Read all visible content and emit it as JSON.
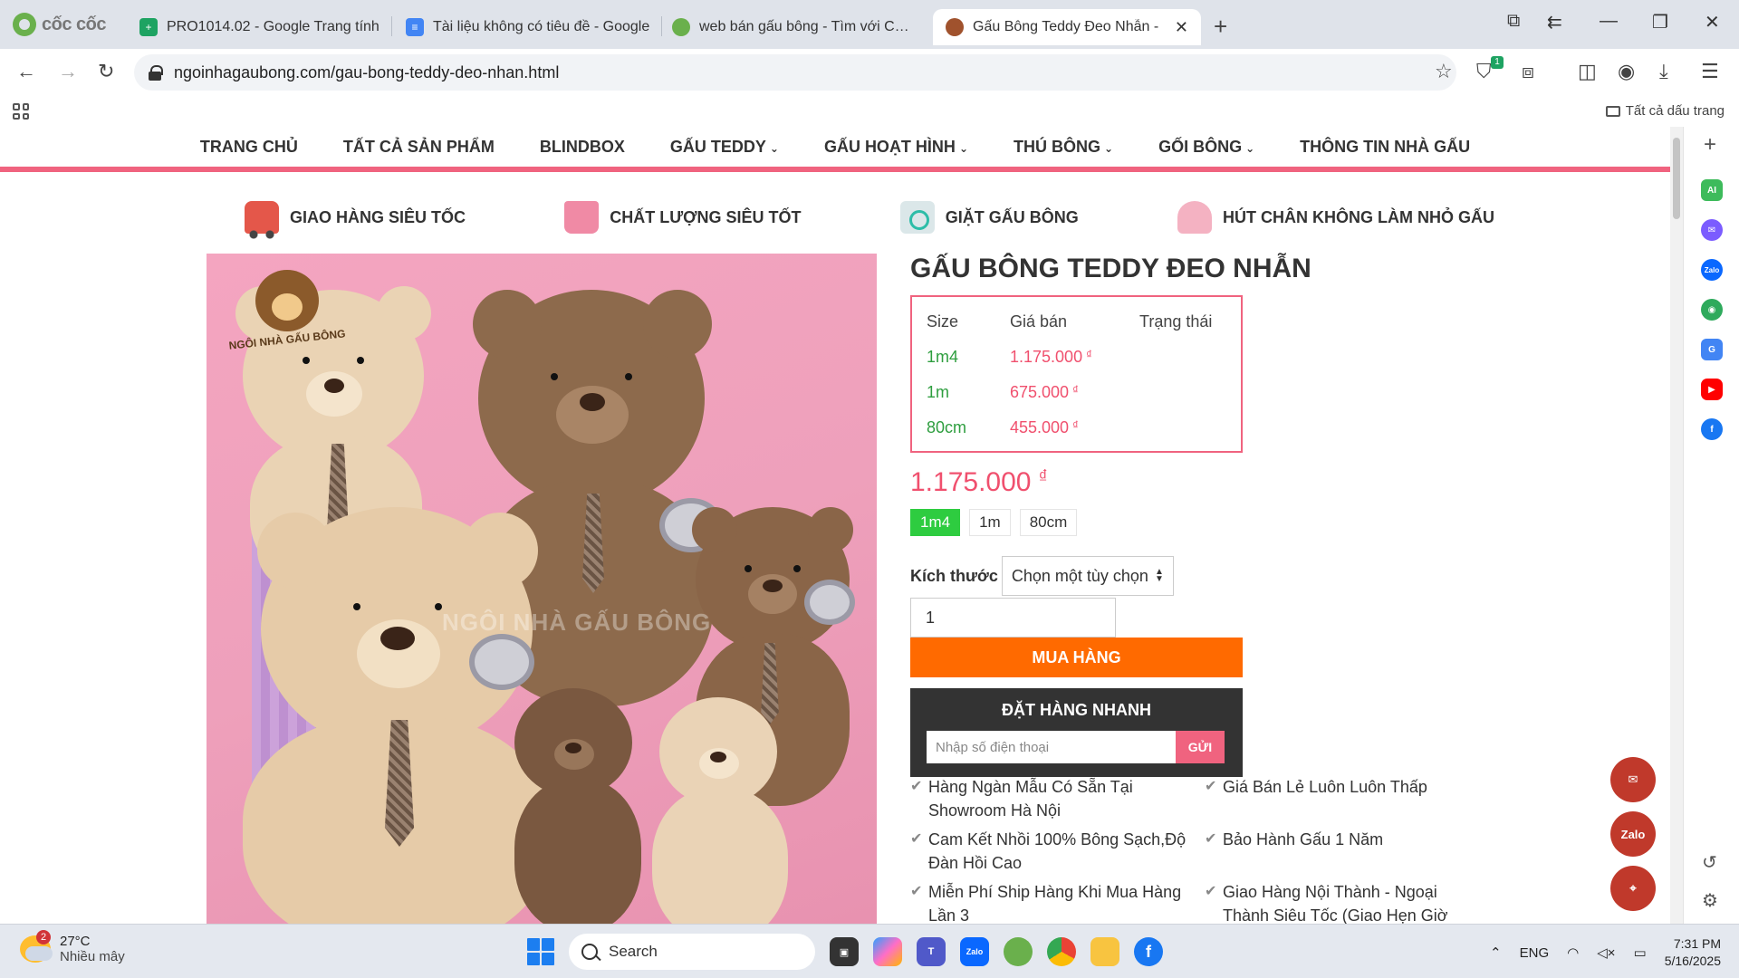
{
  "browser": {
    "brand": "cốc cốc",
    "tabs": [
      {
        "title": "PRO1014.02 - Google Trang tính"
      },
      {
        "title": "Tài liệu không có tiêu đề - Google"
      },
      {
        "title": "web bán gấu bông - Tìm với Cốc C"
      },
      {
        "title": "Gấu Bông Teddy Đeo Nhẫn -"
      }
    ],
    "url": "ngoinhagaubong.com/gau-bong-teddy-deo-nhan.html",
    "extension_badge": "1",
    "all_bookmarks": "Tất cả dấu trang"
  },
  "site": {
    "nav": [
      {
        "label": "TRANG CHỦ",
        "caret": false
      },
      {
        "label": "TẤT CẢ SẢN PHẨM",
        "caret": false
      },
      {
        "label": "BLINDBOX",
        "caret": false
      },
      {
        "label": "GẤU TEDDY",
        "caret": true
      },
      {
        "label": "GẤU HOẠT HÌNH",
        "caret": true
      },
      {
        "label": "THÚ BÔNG",
        "caret": true
      },
      {
        "label": "GỐI BÔNG",
        "caret": true
      },
      {
        "label": "THÔNG TIN NHÀ GẤU",
        "caret": false
      }
    ],
    "features": [
      {
        "label": "GIAO HÀNG SIÊU TỐC",
        "icon": "truck-icon"
      },
      {
        "label": "CHẤT LƯỢNG SIÊU TỐT",
        "icon": "bag-icon"
      },
      {
        "label": "GIẶT GẤU BÔNG",
        "icon": "washing-machine-icon"
      },
      {
        "label": "HÚT CHÂN KHÔNG LÀM NHỎ GẤU",
        "icon": "vacuum-icon"
      }
    ],
    "image_logo_text": "NGÔI NHÀ GẤU BÔNG",
    "image_watermark": "NGÔI NHÀ GẤU BÔNG"
  },
  "product": {
    "title": "GẤU BÔNG TEDDY ĐEO NHẪN",
    "table_headers": [
      "Size",
      "Giá bán",
      "Trạng thái"
    ],
    "table_rows": [
      {
        "size": "1m4",
        "price": "1.175.000",
        "status": ""
      },
      {
        "size": "1m",
        "price": "675.000",
        "status": ""
      },
      {
        "size": "80cm",
        "price": "455.000",
        "status": ""
      }
    ],
    "currency": "₫",
    "current_price": "1.175.000",
    "size_options": [
      "1m4",
      "1m",
      "80cm"
    ],
    "selected_size": "1m4",
    "attribute_label": "Kích thước",
    "select_placeholder": "Chọn một tùy chọn",
    "quantity": "1",
    "buy_label": "MUA HÀNG",
    "quick_order_title": "ĐẶT HÀNG NHANH",
    "phone_placeholder": "Nhập số điện thoại",
    "send_label": "GỬI",
    "benefits": [
      "Hàng Ngàn Mẫu Có Sẵn Tại Showroom Hà Nội",
      "Giá Bán Lẻ Luôn Luôn Thấp",
      "Cam Kết Nhồi 100% Bông Sạch,Độ Đàn Hồi Cao",
      "Bảo Hành Gấu 1 Năm",
      "Miễn Phí Ship Hàng Khi Mua Hàng Lần 3",
      "Giao Hàng Nội Thành - Ngoại Thành Siêu Tốc (Giao Hẹn Giờ &"
    ]
  },
  "floating": {
    "zalo_label": "Zalo"
  },
  "sidepanel": {
    "ai_label": "AI",
    "zalo_label": "Zalo"
  },
  "taskbar": {
    "weather_badge": "2",
    "temperature": "27°C",
    "weather_desc": "Nhiều mây",
    "search_label": "Search",
    "zalo_label": "Zalo",
    "language": "ENG",
    "time": "7:31 PM",
    "date": "5/16/2025"
  },
  "colors": {
    "accent_pink": "#f0637f",
    "price_red": "#f0506e",
    "size_green": "#2e9e3f",
    "buy_orange": "#ff6a00",
    "chip_green": "#2ecc40"
  }
}
